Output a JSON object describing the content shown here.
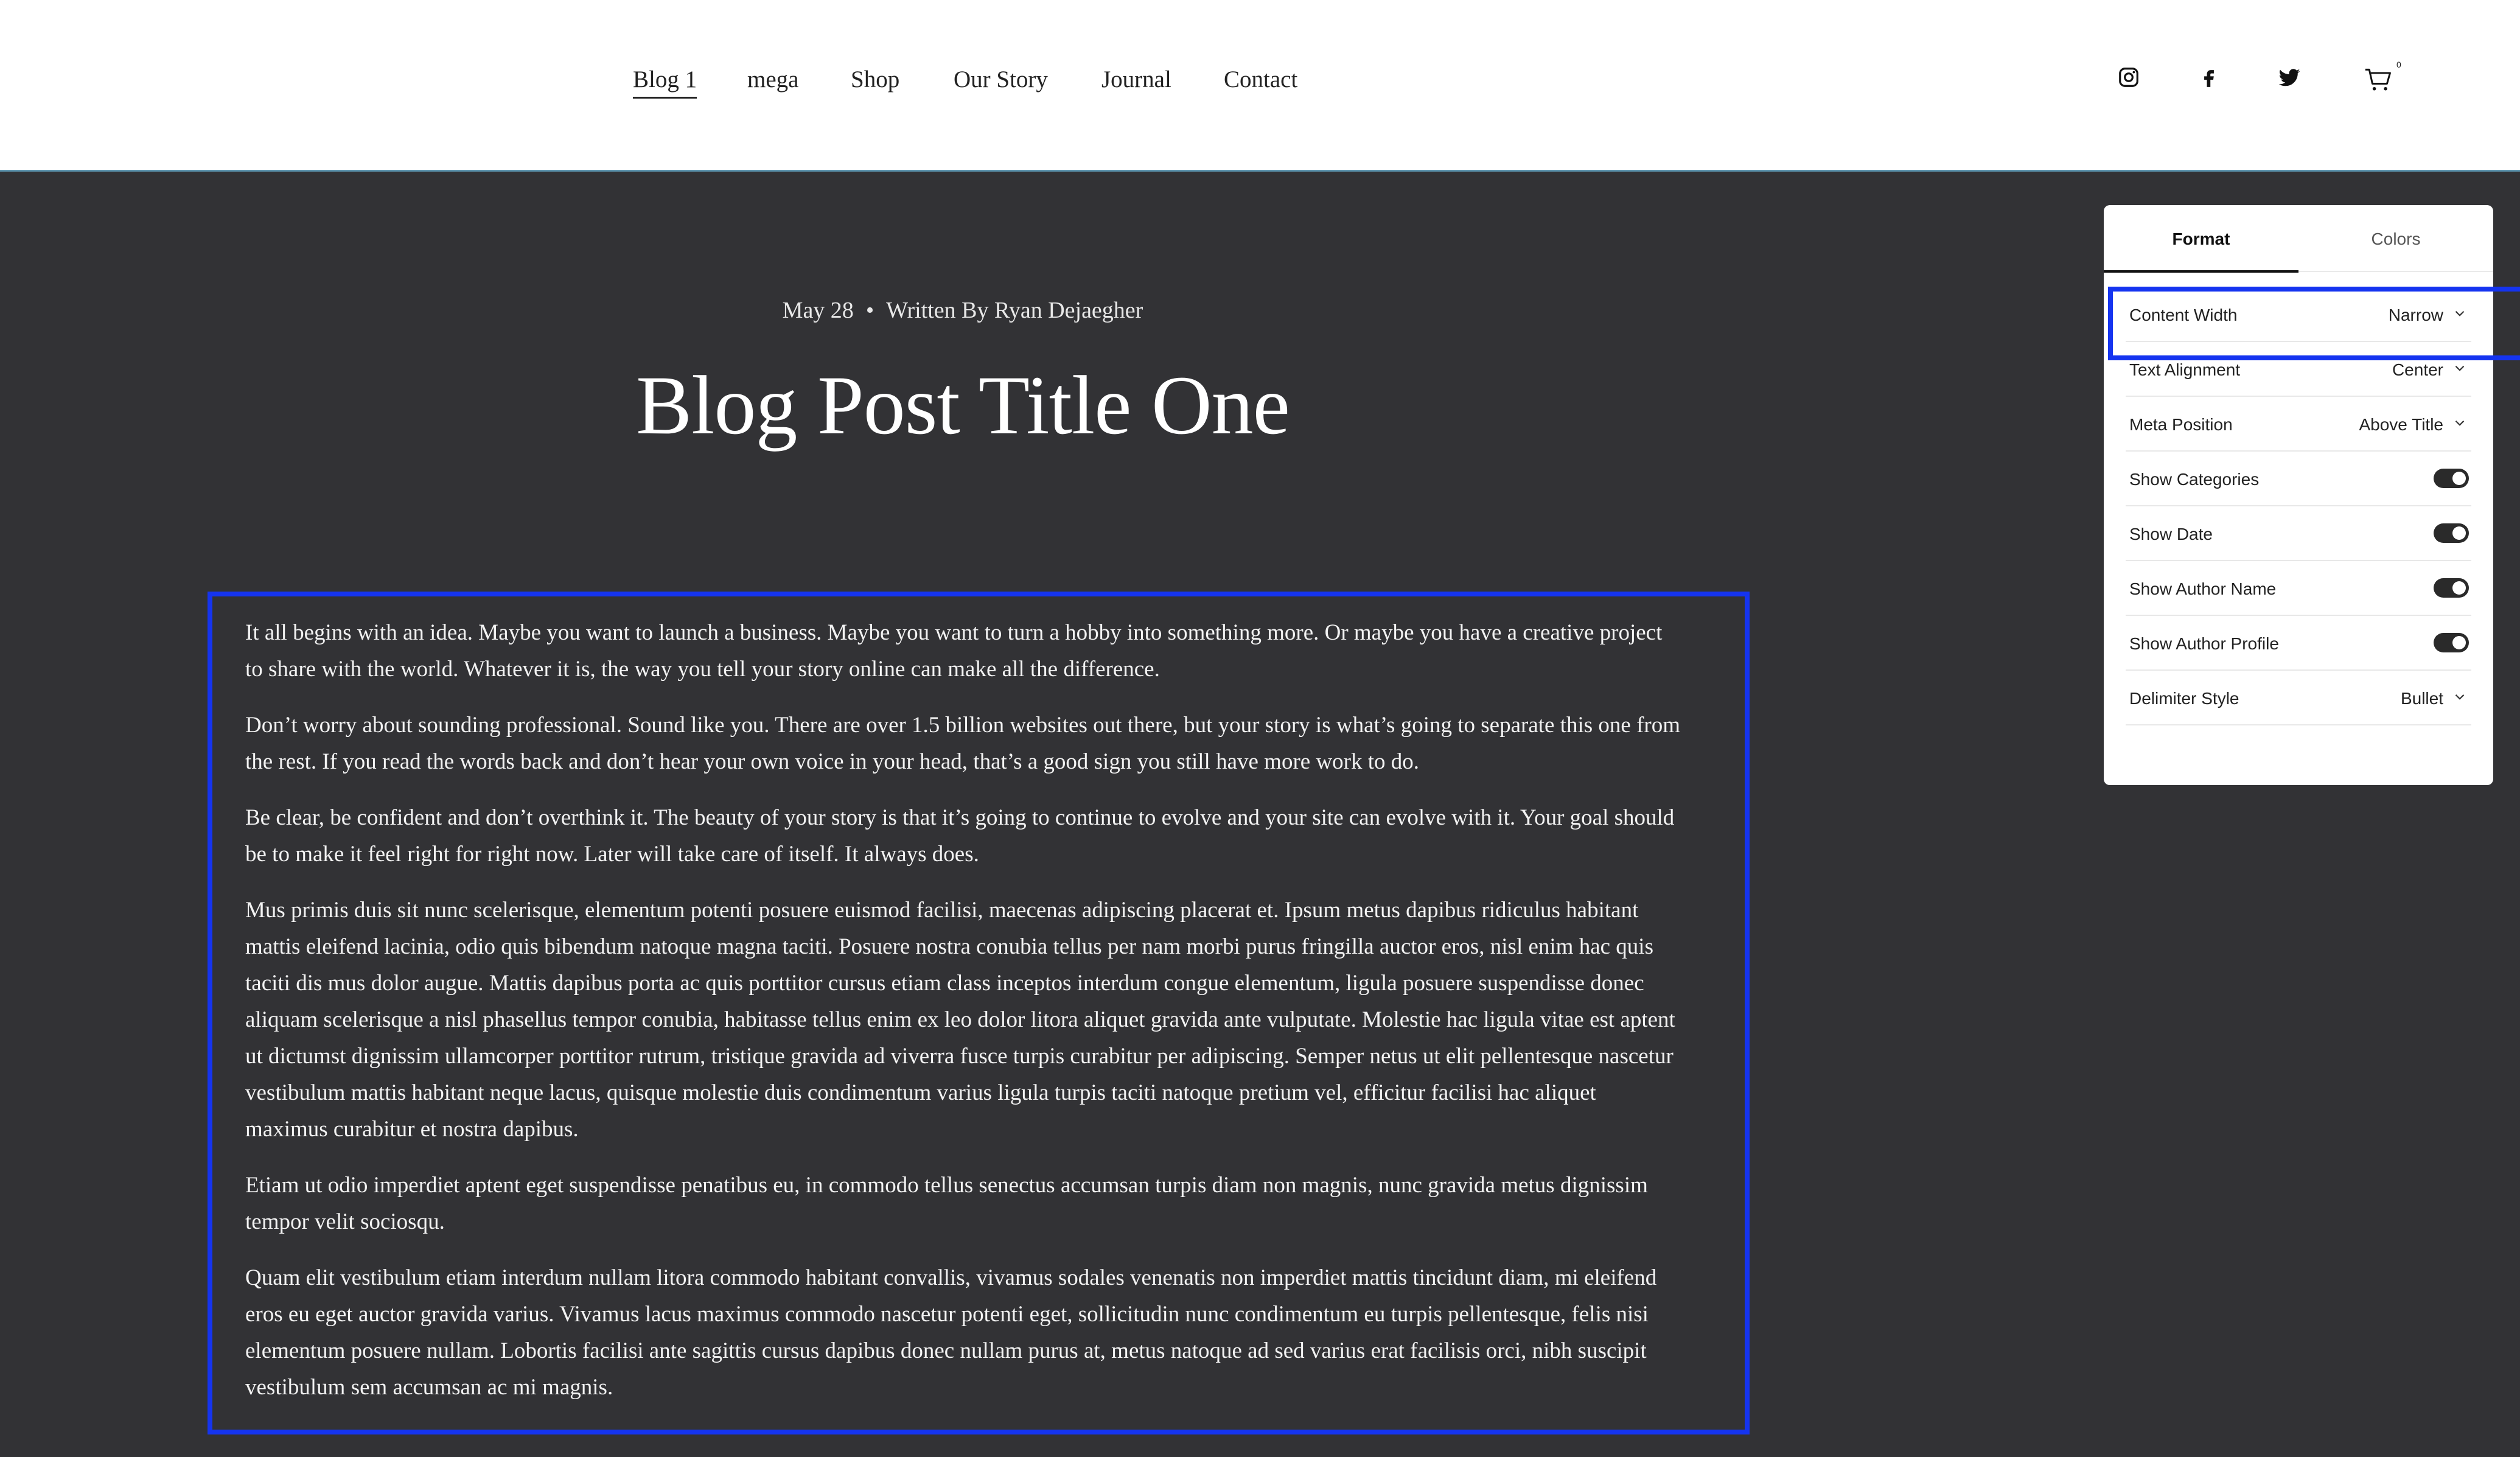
{
  "header": {
    "nav": [
      "Blog 1",
      "mega",
      "Shop",
      "Our Story",
      "Journal",
      "Contact"
    ],
    "social_icons": [
      "instagram-icon",
      "facebook-icon",
      "twitter-icon"
    ],
    "cart_icon": "cart-icon",
    "cart_count": "0"
  },
  "post": {
    "date": "May 28",
    "separator": "•",
    "author": "Written By Ryan Dejaegher",
    "title": "Blog Post Title One",
    "paragraphs": [
      "It all begins with an idea. Maybe you want to launch a business. Maybe you want to turn a hobby into something more. Or maybe you have a creative project to share with the world. Whatever it is, the way you tell your story online can make all the difference.",
      "Don’t worry about sounding professional. Sound like you. There are over 1.5 billion websites out there, but your story is what’s going to separate this one from the rest. If you read the words back and don’t hear your own voice in your head, that’s a good sign you still have more work to do.",
      "Be clear, be confident and don’t overthink it. The beauty of your story is that it’s going to continue to evolve and your site can evolve with it. Your goal should be to make it feel right for right now. Later will take care of itself. It always does.",
      "Mus primis duis sit nunc scelerisque, elementum potenti posuere euismod facilisi, maecenas adipiscing placerat et. Ipsum metus dapibus ridiculus habitant mattis eleifend lacinia, odio quis bibendum natoque magna taciti. Posuere nostra conubia tellus per nam morbi purus fringilla auctor eros, nisl enim hac quis taciti dis mus dolor augue. Mattis dapibus porta ac quis porttitor cursus etiam class inceptos interdum congue elementum, ligula posuere suspendisse donec aliquam scelerisque a nisl phasellus tempor conubia, habitasse tellus enim ex leo dolor litora aliquet gravida ante vulputate. Molestie hac ligula vitae est aptent ut dictumst dignissim ullamcorper porttitor rutrum, tristique gravida ad viverra fusce turpis curabitur per adipiscing. Semper netus ut elit pellentesque nascetur vestibulum mattis habitant neque lacus, quisque molestie duis condimentum varius ligula turpis taciti natoque pretium vel, efficitur facilisi hac aliquet maximus curabitur et nostra dapibus.",
      "Etiam ut odio imperdiet aptent eget suspendisse penatibus eu, in commodo tellus senectus accumsan turpis diam non magnis, nunc gravida metus dignissim tempor velit sociosqu.",
      "Quam elit vestibulum etiam interdum nullam litora commodo habitant convallis, vivamus sodales venenatis non imperdiet mattis tincidunt diam, mi eleifend eros eu eget auctor gravida varius. Vivamus lacus maximus commodo nascetur potenti eget, sollicitudin nunc condimentum eu turpis pellentesque, felis nisi elementum posuere nullam. Lobortis facilisi ante sagittis cursus dapibus donec nullam purus at, metus natoque ad sed varius erat facilisis orci, nibh suscipit vestibulum sem accumsan ac mi magnis."
    ]
  },
  "panel": {
    "tabs": [
      "Format",
      "Colors"
    ],
    "rows": [
      {
        "label": "Content Width",
        "value": "Narrow",
        "kind": "dropdown"
      },
      {
        "label": "Text Alignment",
        "value": "Center",
        "kind": "dropdown"
      },
      {
        "label": "Meta Position",
        "value": "Above Title",
        "kind": "dropdown"
      },
      {
        "label": "Show Categories",
        "value": "on",
        "kind": "toggle"
      },
      {
        "label": "Show Date",
        "value": "on",
        "kind": "toggle"
      },
      {
        "label": "Show Author Name",
        "value": "on",
        "kind": "toggle"
      },
      {
        "label": "Show Author Profile",
        "value": "on",
        "kind": "toggle"
      },
      {
        "label": "Delimiter Style",
        "value": "Bullet",
        "kind": "dropdown"
      }
    ]
  },
  "colors": {
    "page_background": "#323235",
    "header_background": "#ffffff",
    "highlight_border": "#1534f0",
    "toggle_on": "#2a2a2a"
  }
}
